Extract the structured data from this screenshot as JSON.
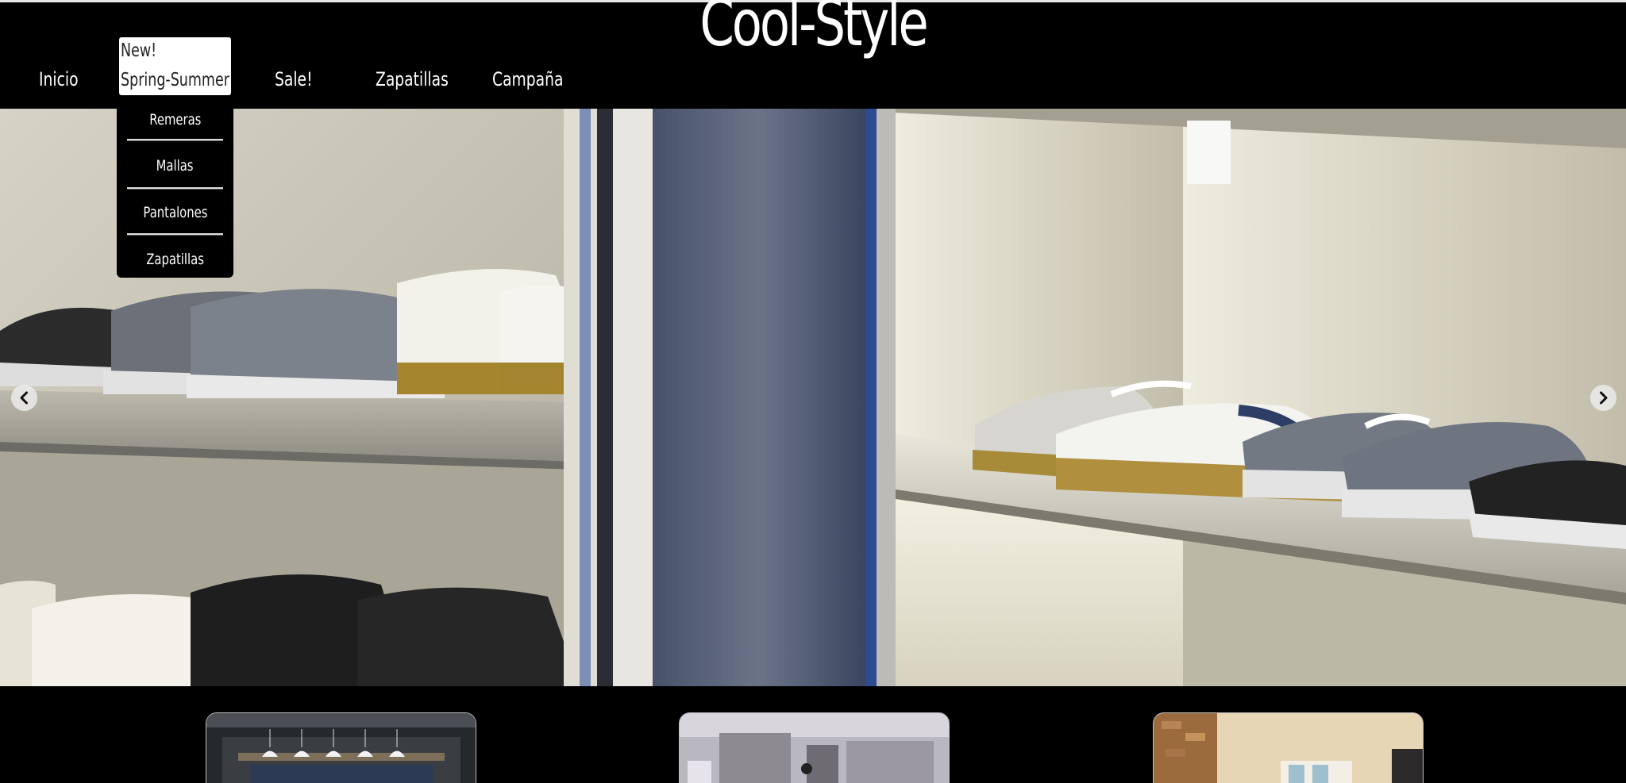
{
  "header": {
    "brand": "Cool-Style"
  },
  "nav": {
    "items": [
      {
        "label": "Inicio"
      },
      {
        "label_line1": "New!",
        "label_line2": "Spring-Summer",
        "active": true
      },
      {
        "label": "Sale!"
      },
      {
        "label": "Zapatillas"
      },
      {
        "label": "Campaña"
      }
    ],
    "dropdown": [
      {
        "label": "Remeras"
      },
      {
        "label": "Mallas"
      },
      {
        "label": "Pantalones"
      },
      {
        "label": "Zapatillas"
      }
    ]
  },
  "carousel": {
    "prev_icon": "chevron-left-icon",
    "next_icon": "chevron-right-icon"
  },
  "thumbnails": [
    {
      "name": "store-interior-lamps"
    },
    {
      "name": "store-interior-display"
    },
    {
      "name": "store-interior-brick"
    }
  ],
  "colors": {
    "background": "#000000",
    "text": "#ffffff",
    "active_nav_bg": "#ffffff"
  }
}
